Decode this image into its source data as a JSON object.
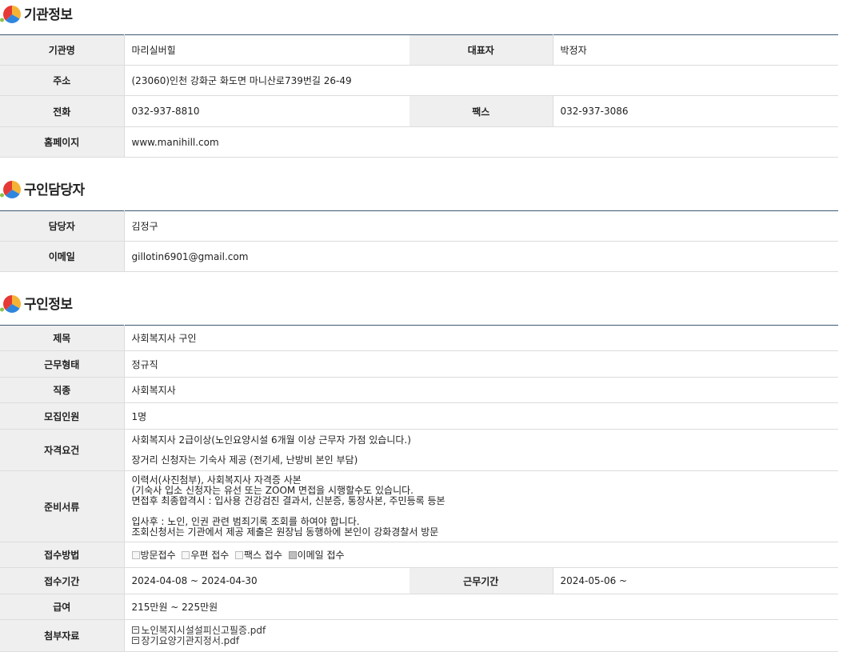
{
  "org_section": {
    "title": "기관정보",
    "labels": {
      "name": "기관명",
      "rep": "대표자",
      "address": "주소",
      "phone": "전화",
      "fax": "팩스",
      "homepage": "홈페이지"
    },
    "values": {
      "name": "마리실버힐",
      "rep": "박정자",
      "address": "(23060)인천 강화군 화도면 마니산로739번길 26-49",
      "phone": "032-937-8810",
      "fax": "032-937-3086",
      "homepage": "www.manihill.com"
    }
  },
  "contact_section": {
    "title": "구인담당자",
    "labels": {
      "person": "담당자",
      "email": "이메일"
    },
    "values": {
      "person": "김정구",
      "email": "gillotin6901@gmail.com"
    }
  },
  "job_section": {
    "title": "구인정보",
    "labels": {
      "subject": "제목",
      "employment_type": "근무형태",
      "job_type": "직종",
      "headcount": "모집인원",
      "qualification": "자격요건",
      "documents": "준비서류",
      "method": "접수방법",
      "period": "접수기간",
      "work_period": "근무기간",
      "salary": "급여",
      "attachments": "첨부자료"
    },
    "values": {
      "subject": "사회복지사 구인",
      "employment_type": "정규직",
      "job_type": "사회복지사",
      "headcount": "1명",
      "qualification": [
        "사회복지사 2급이상(노인요양시설 6개월 이상 근무자 가점 있습니다.)",
        "장거리 신청자는 기숙사 제공 (전기세, 난방비 본인 부담)"
      ],
      "documents": [
        "이력서(사진첨부), 사회복지사 자격증 사본",
        "(기숙사 입소 신청자는 유선 또는 ZOOM 면접을 시행할수도 있습니다.",
        "면접후 최종합격시 : 입사용 건강검진 결과서, 신분증, 통장사본, 주민등록 등본",
        "",
        "입사후 : 노인, 인권 관련 범죄기록 조회를 하여야 합니다.",
        "조회신청서는 기관에서 제공 제출은 원장님 동행하에 본인이 강화경찰서 방문"
      ],
      "methods": [
        {
          "label": "방문접수",
          "checked": false
        },
        {
          "label": "우편 접수",
          "checked": false
        },
        {
          "label": "팩스 접수",
          "checked": false
        },
        {
          "label": "이메일 접수",
          "checked": true
        }
      ],
      "period": "2024-04-08 ~ 2024-04-30",
      "work_period": "2024-05-06 ~",
      "salary": "215만원 ~ 225만원",
      "attachments": [
        "노인복지시설설피신고필증.pdf",
        "장기요양기관지정서.pdf"
      ]
    }
  }
}
